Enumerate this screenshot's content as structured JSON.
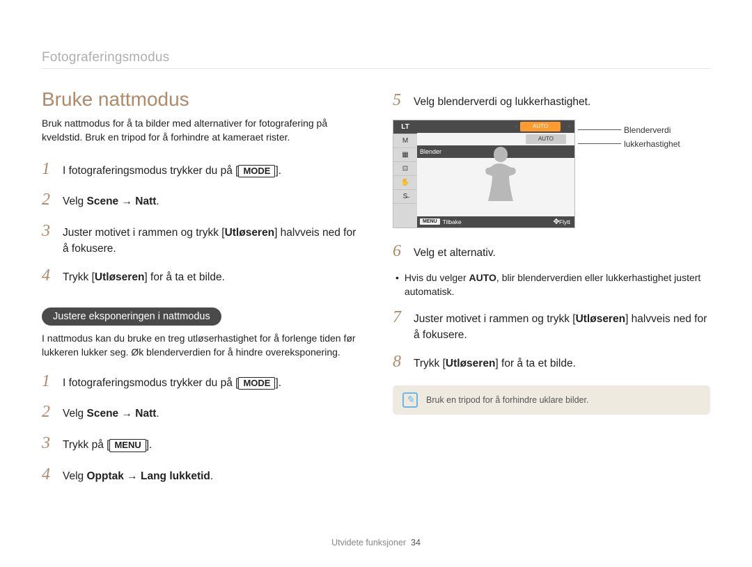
{
  "header": {
    "breadcrumb": "Fotograferingsmodus"
  },
  "title": "Bruke nattmodus",
  "intro": "Bruk nattmodus for å ta bilder med alternativer for fotografering på kveldstid. Bruk en tripod for å forhindre at kameraet rister.",
  "steps_a": [
    {
      "n": "1",
      "pre": "I fotograferingsmodus trykker du på [",
      "btn": "MODE",
      "post": "]."
    },
    {
      "n": "2",
      "pre": "Velg ",
      "bold": "Scene → Natt",
      "post": "."
    },
    {
      "n": "3",
      "pre": "Juster motivet i rammen og trykk [",
      "bold2": "Utløseren",
      "post": "] halvveis ned for å fokusere."
    },
    {
      "n": "4",
      "pre": "Trykk [",
      "bold2": "Utløseren",
      "post": "] for å ta et bilde."
    }
  ],
  "pill": "Justere eksponeringen i nattmodus",
  "subtext": "I nattmodus kan du bruke en treg utløserhastighet for å forlenge tiden før lukkeren lukker seg. Øk blenderverdien for å hindre overeksponering.",
  "steps_b": [
    {
      "n": "1",
      "pre": "I fotograferingsmodus trykker du på [",
      "btn": "MODE",
      "post": "]."
    },
    {
      "n": "2",
      "pre": "Velg ",
      "bold": "Scene → Natt",
      "post": "."
    },
    {
      "n": "3",
      "pre": "Trykk på [",
      "btn": "MENU",
      "post": "]."
    },
    {
      "n": "4",
      "pre": "Velg ",
      "bold": "Opptak → Lang lukketid",
      "post": "."
    }
  ],
  "steps_c": [
    {
      "n": "5",
      "text": "Velg blenderverdi og lukkerhastighet."
    },
    {
      "n": "6",
      "text": "Velg et alternativ."
    },
    {
      "n": "7",
      "pre": "Juster motivet i rammen og trykk [",
      "bold2": "Utløseren",
      "post": "] halvveis ned for å fokusere."
    },
    {
      "n": "8",
      "pre": "Trykk [",
      "bold2": "Utløseren",
      "post": "] for å ta et bilde."
    }
  ],
  "bullet6": {
    "pre": "Hvis du velger ",
    "bold": "AUTO",
    "post": ", blir blenderverdien eller lukkerhastighet justert automatisk."
  },
  "lcd": {
    "side": [
      "LT",
      "M",
      "▦",
      "⊡",
      "✋",
      "S̶"
    ],
    "row1_val": "AUTO",
    "row2_label": "Blender",
    "row2_val": "AUTO",
    "back_label": "Tilbake",
    "back_btn": "MENU",
    "move_label": "Flytt"
  },
  "callouts": {
    "c1": "Blenderverdi",
    "c2": "lukkerhastighet"
  },
  "tip": "Bruk en tripod for å forhindre uklare bilder.",
  "footer": {
    "section": "Utvidete funksjoner",
    "page": "34"
  }
}
